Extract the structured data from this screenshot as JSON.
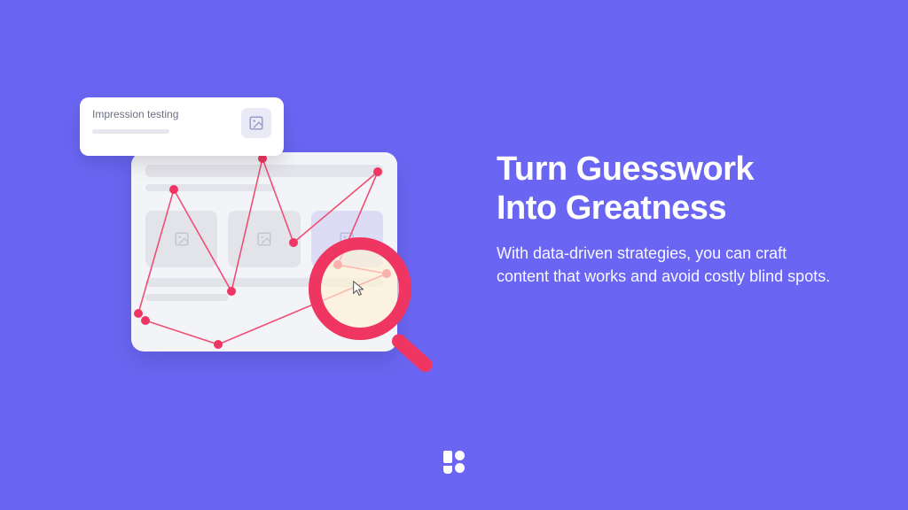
{
  "headline_line1": "Turn Guesswork",
  "headline_line2": "Into Greatness",
  "subtext": "With data-driven strategies, you can craft content that works and avoid costly blind spots.",
  "impression_card": {
    "label": "Impression testing"
  },
  "colors": {
    "background": "#6a66f3",
    "accent": "#ef3662"
  }
}
